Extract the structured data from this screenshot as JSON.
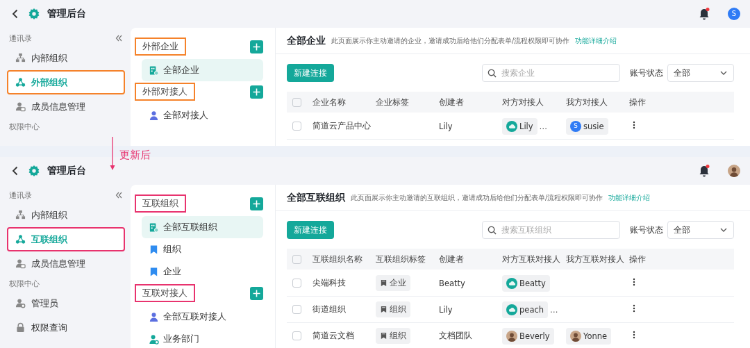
{
  "panels": [
    {
      "color": "#f5822a",
      "header": {
        "title": "管理后台",
        "notification_dot": true,
        "avatar": {
          "kind": "letter",
          "text": "S"
        }
      },
      "sidebar": {
        "sections": [
          {
            "label": "通讯录",
            "items": [
              {
                "label": "内部组织",
                "kind": "org",
                "selected": false,
                "boxed": false
              },
              {
                "label": "外部组织",
                "kind": "network",
                "selected": true,
                "boxed": true
              },
              {
                "label": "成员信息管理",
                "kind": "member",
                "selected": false,
                "boxed": false
              }
            ]
          },
          {
            "label": "权限中心"
          }
        ]
      },
      "middle": {
        "groups": [
          {
            "title": "外部企业",
            "boxed": true,
            "items": [
              {
                "label": "全部企业",
                "kind": "all",
                "selected": true
              }
            ]
          },
          {
            "title": "外部对接人",
            "boxed": true,
            "items": [
              {
                "label": "全部对接人",
                "kind": "person",
                "selected": false
              }
            ]
          }
        ]
      },
      "main": {
        "title": "全部企业",
        "description": "此页面展示你主动邀请的企业，邀请成功后给他们分配表单/流程权限即可协作",
        "link": "功能详细介绍",
        "new_button": "新建连接",
        "search": {
          "placeholder": "搜索企业"
        },
        "status_filter": {
          "label": "账号状态",
          "value": "全部"
        },
        "table": {
          "columns": [
            "企业名称",
            "企业标签",
            "创建者",
            "对方对接人",
            "我方对接人",
            "操作"
          ],
          "header_checked": false,
          "rows": [
            {
              "checked": false,
              "name": "简道云产品中心",
              "creator": "Lily",
              "their_contact": {
                "name": "Lily",
                "avatar": {
                  "kind": "logo"
                },
                "more": "…"
              },
              "our_contact": {
                "name": "susie",
                "avatar": {
                  "kind": "letter",
                  "text": "S"
                }
              }
            }
          ]
        }
      }
    },
    {
      "color": "#e8336e",
      "header": {
        "title": "管理后台",
        "notification_dot": true,
        "avatar": {
          "kind": "photo"
        }
      },
      "sidebar": {
        "sections": [
          {
            "label": "通讯录",
            "items": [
              {
                "label": "内部组织",
                "kind": "org",
                "selected": false,
                "boxed": false
              },
              {
                "label": "互联组织",
                "kind": "network",
                "selected": true,
                "boxed": true
              },
              {
                "label": "成员信息管理",
                "kind": "member",
                "selected": false,
                "boxed": false
              }
            ]
          },
          {
            "label": "权限中心",
            "items": [
              {
                "label": "管理员",
                "kind": "admin",
                "selected": false,
                "boxed": false
              },
              {
                "label": "权限查询",
                "kind": "lock",
                "selected": false,
                "boxed": false
              }
            ]
          }
        ]
      },
      "middle": {
        "groups": [
          {
            "title": "互联组织",
            "boxed": true,
            "items": [
              {
                "label": "全部互联组织",
                "kind": "all",
                "selected": true
              },
              {
                "label": "组织",
                "kind": "tag",
                "selected": false
              },
              {
                "label": "企业",
                "kind": "tag",
                "selected": false
              }
            ]
          },
          {
            "title": "互联对接人",
            "boxed": true,
            "items": [
              {
                "label": "全部互联对接人",
                "kind": "person",
                "selected": false
              },
              {
                "label": "业务部门",
                "kind": "dept",
                "selected": false
              }
            ]
          }
        ]
      },
      "main": {
        "title": "全部互联组织",
        "description": "此页面展示你主动邀请的互联组织，邀请成功后给他们分配表单/流程权限即可协作",
        "link": "功能详细介绍",
        "new_button": "新建连接",
        "search": {
          "placeholder": "搜索互联组织"
        },
        "status_filter": {
          "label": "账号状态",
          "value": "全部"
        },
        "table": {
          "columns": [
            "互联组织名称",
            "互联组织标签",
            "创建者",
            "对方互联对接人",
            "我方互联对接人",
            "操作"
          ],
          "header_checked": false,
          "rows": [
            {
              "checked": false,
              "name": "尖端科技",
              "tag": "企业",
              "creator": "Beatty",
              "their_contact": {
                "name": "Beatty",
                "avatar": {
                  "kind": "logo"
                }
              }
            },
            {
              "checked": false,
              "name": "街道组织",
              "tag": "组织",
              "creator": "Lily",
              "their_contact": {
                "name": "peach",
                "avatar": {
                  "kind": "logo"
                },
                "more": "…"
              }
            },
            {
              "checked": false,
              "name": "简道云文档",
              "tag": "组织",
              "creator": "文档团队",
              "their_contact": {
                "name": "Beverly",
                "avatar": {
                  "kind": "photo"
                }
              },
              "our_contact": {
                "name": "Yonne",
                "avatar": {
                  "kind": "photo"
                }
              }
            }
          ]
        }
      }
    }
  ],
  "annotation": {
    "text": "更新后"
  }
}
